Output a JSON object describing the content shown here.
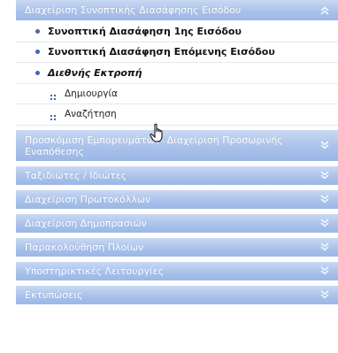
{
  "menu": {
    "open_section": {
      "title": "Διαχείριση Συνοπτικής Διασάφησης Εισόδου",
      "items": [
        {
          "label": "Συνοπτική Διασάφηση 1ης Εισόδου"
        },
        {
          "label": "Συνοπτική Διασάφηση Επόμενης Εισόδου"
        },
        {
          "label": "Διεθνής Εκτροπή"
        }
      ],
      "subitems": [
        {
          "label": "Δημιουργία"
        },
        {
          "label": "Αναζήτηση"
        }
      ]
    },
    "sections": [
      {
        "title": "Προσκόμιση Εμπορευμάτων- Διαχείριση Προσωρινής Εναπόθεσης"
      },
      {
        "title": "Ταξιδιώτες / Ιδιώτες"
      },
      {
        "title": "Διαχείριση Πρωτοκόλλων"
      },
      {
        "title": "Διαχείριση Δημοπρασιών"
      },
      {
        "title": "Παρακολούθηση Πλοίων"
      },
      {
        "title": "Υποστηρικτικές Λειτουργίες"
      },
      {
        "title": "Εκτυπώσεις"
      }
    ]
  },
  "icons": {
    "collapse": "chevron-double-up-icon",
    "expand": "chevron-double-down-icon",
    "bullet": "bullet-dot-icon",
    "subbullet": "four-dots-icon",
    "pointer": "hand-pointer-icon"
  },
  "colors": {
    "header_top": "#c9d9f3",
    "header_bottom": "#9bb7e6",
    "header_text": "#ffffff",
    "bullet": "#3f66b3"
  }
}
